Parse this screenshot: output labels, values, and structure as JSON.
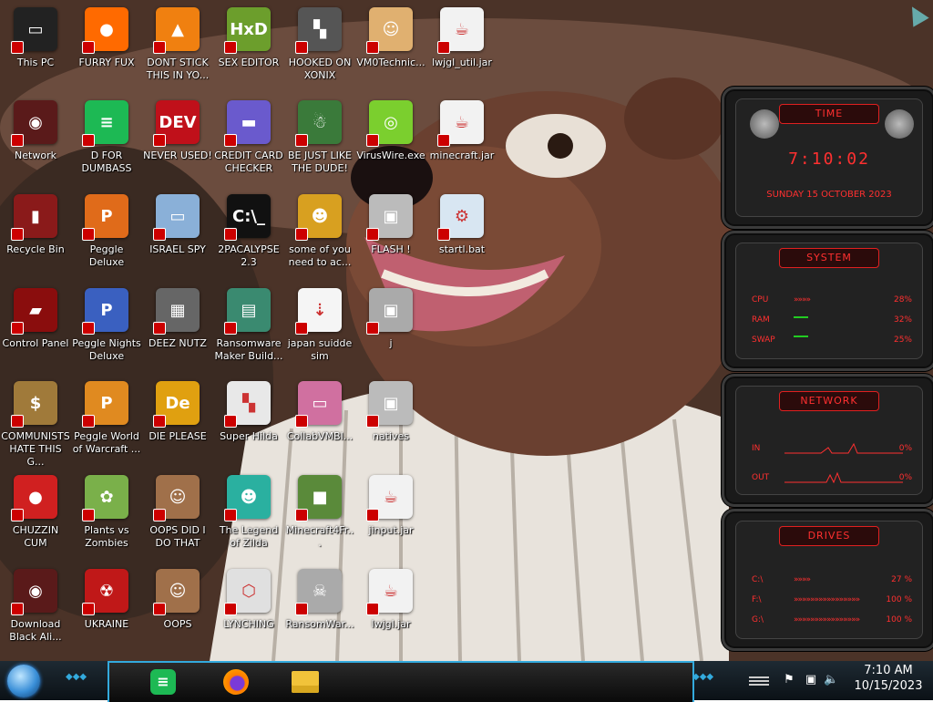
{
  "desktop": {
    "icons": [
      {
        "label": "This PC",
        "glyph": "▭",
        "color": "#222"
      },
      {
        "label": "FURRY FUX",
        "glyph": "●",
        "color": "#ff6a00"
      },
      {
        "label": "DONT STICK THIS IN YO...",
        "glyph": "▲",
        "color": "#f08010"
      },
      {
        "label": "SEX EDITOR",
        "glyph": "HxD",
        "color": "#6c9e2c"
      },
      {
        "label": "HOOKED ON XONIX",
        "glyph": "▚",
        "color": "#555"
      },
      {
        "label": "VM0Technic...",
        "glyph": "☺",
        "color": "#e0b070"
      },
      {
        "label": "lwjgl_util.jar",
        "glyph": "☕",
        "color": "#f2f2f2"
      },
      {
        "label": "Network",
        "glyph": "◉",
        "color": "#5a1a1a"
      },
      {
        "label": "D FOR DUMBASS",
        "glyph": "≡",
        "color": "#1db954"
      },
      {
        "label": "NEVER USED!",
        "glyph": "DEV",
        "color": "#c0101a"
      },
      {
        "label": "CREDIT CARD CHECKER",
        "glyph": "▬",
        "color": "#6a5acd"
      },
      {
        "label": "BE JUST LIKE THE DUDE!",
        "glyph": "☃",
        "color": "#3a7a3a"
      },
      {
        "label": "VirusWire.exe",
        "glyph": "◎",
        "color": "#7bcf2e"
      },
      {
        "label": "minecraft.jar",
        "glyph": "☕",
        "color": "#f2f2f2"
      },
      {
        "label": "Recycle Bin",
        "glyph": "▮",
        "color": "#8a1a1a"
      },
      {
        "label": "Peggle Deluxe",
        "glyph": "P",
        "color": "#e06b1a"
      },
      {
        "label": "ISRAEL SPY",
        "glyph": "▭",
        "color": "#8ab0d8"
      },
      {
        "label": "2PACALYPSE 2.3",
        "glyph": "C:\\_",
        "color": "#111"
      },
      {
        "label": "some of you need to ac...",
        "glyph": "☻",
        "color": "#d8a020"
      },
      {
        "label": "FLASH !",
        "glyph": "▣",
        "color": "#bbb"
      },
      {
        "label": "startl.bat",
        "glyph": "⚙",
        "color": "#d8e6f2"
      },
      {
        "label": "Control Panel",
        "glyph": "▰",
        "color": "#8a0d0d"
      },
      {
        "label": "Peggle Nights Deluxe",
        "glyph": "P",
        "color": "#3a60c0"
      },
      {
        "label": "DEEZ NUTZ",
        "glyph": "▦",
        "color": "#666"
      },
      {
        "label": "Ransomware Maker Build...",
        "glyph": "▤",
        "color": "#3a8a70"
      },
      {
        "label": "japan suidde sim",
        "glyph": "⇣",
        "color": "#f5f5f5"
      },
      {
        "label": "j",
        "glyph": "▣",
        "color": "#aaa"
      },
      {
        "label": "COMMUNISTS HATE THIS G...",
        "glyph": "$",
        "color": "#a07a3a"
      },
      {
        "label": "Peggle World of Warcraft ...",
        "glyph": "P",
        "color": "#e08a20"
      },
      {
        "label": "DIE PLEASE",
        "glyph": "De",
        "color": "#e0a010"
      },
      {
        "label": "Super Hilda",
        "glyph": "▚",
        "color": "#e8e8e8"
      },
      {
        "label": "CollabVMBl...",
        "glyph": "▭",
        "color": "#d070a0"
      },
      {
        "label": "natives",
        "glyph": "▣",
        "color": "#bbb"
      },
      {
        "label": "CHUZZIN CUM",
        "glyph": "●",
        "color": "#d02020"
      },
      {
        "label": "Plants vs Zombies",
        "glyph": "✿",
        "color": "#7ab04a"
      },
      {
        "label": "OOPS DID I DO THAT",
        "glyph": "☺",
        "color": "#a0704a"
      },
      {
        "label": "The Legend of Zilda",
        "glyph": "☻",
        "color": "#2ab0a0"
      },
      {
        "label": "Minecraft4Fr...",
        "glyph": "■",
        "color": "#5a8a3a"
      },
      {
        "label": "jinput.jar",
        "glyph": "☕",
        "color": "#f2f2f2"
      },
      {
        "label": "Download Black Ali...",
        "glyph": "◉",
        "color": "#5a1a1a"
      },
      {
        "label": "UKRAINE",
        "glyph": "☢",
        "color": "#c01818"
      },
      {
        "label": "OOPS",
        "glyph": "☺",
        "color": "#a0704a"
      },
      {
        "label": "LYNCHING",
        "glyph": "⬡",
        "color": "#e0e0e0"
      },
      {
        "label": "RansomWar...",
        "glyph": "☠",
        "color": "#aaa"
      },
      {
        "label": "lwjgl.jar",
        "glyph": "☕",
        "color": "#f2f2f2"
      }
    ]
  },
  "widget": {
    "time": {
      "title": "TIME",
      "clock": "7:10:02",
      "date": "SUNDAY 15 OCTOBER 2023"
    },
    "system": {
      "title": "SYSTEM",
      "rows": [
        {
          "label": "CPU",
          "arrows": "»»»»",
          "value": "28%"
        },
        {
          "label": "RAM",
          "arrows": "",
          "value": "32%"
        },
        {
          "label": "SWAP",
          "arrows": "",
          "value": "25%"
        }
      ]
    },
    "network": {
      "title": "NETWORK",
      "rows": [
        {
          "label": "IN",
          "value": "0%"
        },
        {
          "label": "OUT",
          "value": "0%"
        }
      ]
    },
    "drives": {
      "title": "DRIVES",
      "rows": [
        {
          "label": "C:\\",
          "arrows": "»»»»",
          "value": "27 %"
        },
        {
          "label": "F:\\",
          "arrows": "»»»»»»»»»»»»»»»»",
          "value": "100 %"
        },
        {
          "label": "G:\\",
          "arrows": "»»»»»»»»»»»»»»»»",
          "value": "100 %"
        }
      ]
    }
  },
  "taskbar": {
    "clock_time": "7:10 AM",
    "clock_date": "10/15/2023"
  },
  "colors": {
    "accent": "#ff3030",
    "taskbar_trim": "#33aadd"
  }
}
